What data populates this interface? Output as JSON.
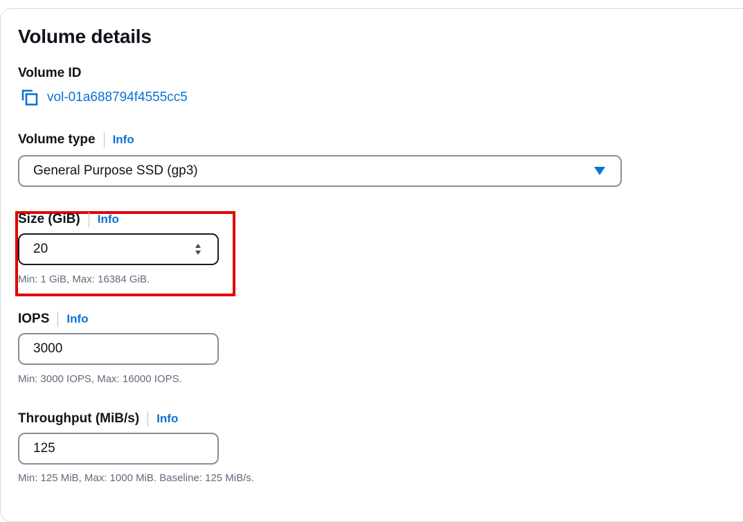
{
  "section": {
    "title": "Volume details"
  },
  "volume_id": {
    "label": "Volume ID",
    "value": "vol-01a688794f4555cc5",
    "icon": "copy-icon"
  },
  "volume_type": {
    "label": "Volume type",
    "info": "Info",
    "selected": "General Purpose SSD (gp3)",
    "icon": "caret-down-icon"
  },
  "size": {
    "label": "Size (GiB)",
    "info": "Info",
    "value": "20",
    "hint": "Min: 1 GiB, Max: 16384 GiB."
  },
  "iops": {
    "label": "IOPS",
    "info": "Info",
    "value": "3000",
    "hint": "Min: 3000 IOPS, Max: 16000 IOPS."
  },
  "throughput": {
    "label": "Throughput (MiB/s)",
    "info": "Info",
    "value": "125",
    "hint": "Min: 125 MiB, Max: 1000 MiB. Baseline: 125 MiB/s."
  },
  "colors": {
    "link": "#0972d3",
    "highlight_box": "#e00000",
    "focused_border": "#0f1b2a"
  }
}
